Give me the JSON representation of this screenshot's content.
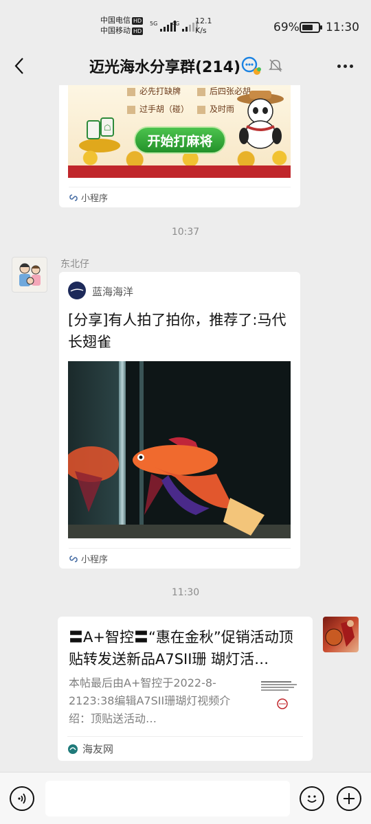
{
  "status_bar": {
    "carrier1": "中国电信",
    "carrier2": "中国移动",
    "hd": "HD",
    "net1": "5G",
    "net2": "4G",
    "speed_value": "12.1",
    "speed_unit": "K/s",
    "battery_percent": "69%",
    "battery_level": 0.69,
    "time": "11:30"
  },
  "header": {
    "title": "迈光海水分享群(214)",
    "icons": [
      "back-icon",
      "group-chat-icon",
      "mute-bell-icon",
      "more-icon"
    ]
  },
  "messages": [
    {
      "type": "mini-program",
      "image_texts": [
        "必先打缺牌",
        "后四张必胡",
        "过手胡（碰）",
        "及时雨"
      ],
      "button_text": "开始打麻将",
      "footer": "小程序"
    },
    {
      "type": "timestamp",
      "text": "10:37"
    },
    {
      "type": "mini-program",
      "sender": "东北仔",
      "source_name": "蓝海海洋",
      "title": "[分享]有人拍了拍你，推荐了:马代长翅雀",
      "footer": "小程序"
    },
    {
      "type": "timestamp",
      "text": "11:30"
    },
    {
      "type": "link",
      "title": "〓A+智控〓“惠在金秋”促销活动顶贴转发送新品A7SII珊 瑚灯活…",
      "description": "本帖最后由A+智控于2022-8-2123:38编辑A7SII珊瑚灯视频介绍：顶贴送活动…",
      "source": "海友网"
    }
  ],
  "colors": {
    "background": "#ededed",
    "bubble": "#ffffff",
    "game_green": "#2fa531",
    "game_red": "#c0262b"
  }
}
